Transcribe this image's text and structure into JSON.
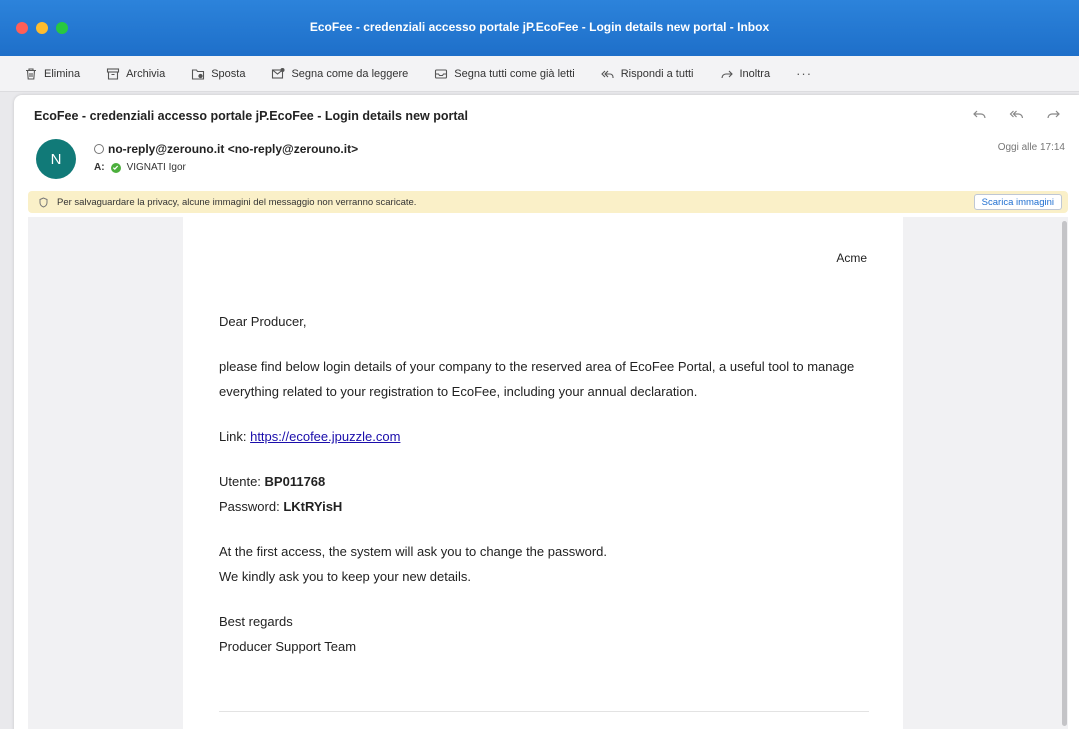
{
  "window": {
    "title": "EcoFee - credenziali accesso portale jP.EcoFee - Login details new portal - Inbox"
  },
  "toolbar": {
    "delete_label": "Elimina",
    "archive_label": "Archivia",
    "move_label": "Sposta",
    "mark_unread_label": "Segna come da leggere",
    "mark_all_read_label": "Segna tutti come già letti",
    "reply_all_label": "Rispondi a tutti",
    "forward_label": "Inoltra",
    "more_label": "···"
  },
  "message": {
    "subject": "EcoFee - credenziali accesso portale jP.EcoFee - Login details new portal",
    "avatar_initial": "N",
    "sender": "no-reply@zerouno.it <no-reply@zerouno.it>",
    "to_label": "A:",
    "recipient": "VIGNATI Igor",
    "date": "Oggi alle 17:14"
  },
  "banner": {
    "text": "Per salvaguardare la privacy, alcune immagini del messaggio non verranno scaricate.",
    "button_label": "Scarica immagini"
  },
  "body": {
    "company": "Acme",
    "greeting": "Dear Producer,",
    "intro": "please find below login details of your company to the reserved area of EcoFee Portal, a useful tool to manage everything related to your registration to EcoFee, including your annual declaration.",
    "link_label": "Link:",
    "link_url": "https://ecofee.jpuzzle.com",
    "user_label": "Utente:",
    "user_value": "BP011768",
    "password_label": "Password:",
    "password_value": "LKtRYisH",
    "first_access": "At the first access, the system will ask you to change the password.",
    "keep_details": "We kindly ask you to keep your new details.",
    "regards": "Best regards",
    "team": "Producer Support Team"
  },
  "colors": {
    "titlebar": "#1e6fc9",
    "avatar": "#117a78",
    "banner": "#faf0c8",
    "link": "#1a0dab"
  }
}
